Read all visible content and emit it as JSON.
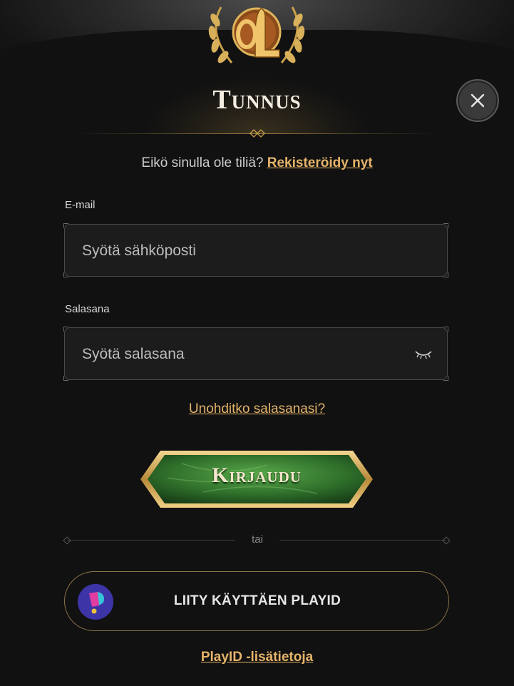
{
  "modal": {
    "title": "Tunnus",
    "close_icon": "close-icon"
  },
  "register": {
    "prompt": "Eikö sinulla ole tiliä?",
    "link": "Rekisteröidy nyt"
  },
  "email": {
    "label": "E-mail",
    "placeholder": "Syötä sähköposti",
    "value": ""
  },
  "password": {
    "label": "Salasana",
    "placeholder": "Syötä salasana",
    "value": "",
    "toggle_icon": "eye-closed-icon"
  },
  "forgot_link": "Unohditko salasanasi?",
  "login_button": "Kirjaudu",
  "separator": "tai",
  "playid": {
    "button_label": "LIITY KÄYTTÄEN PLAYID",
    "icon": "playid-logo-icon",
    "info_link": "PlayID -lisätietoja"
  },
  "colors": {
    "accent_gold": "#e6b46a",
    "button_green": "#2f7a2c",
    "background": "#141414"
  }
}
